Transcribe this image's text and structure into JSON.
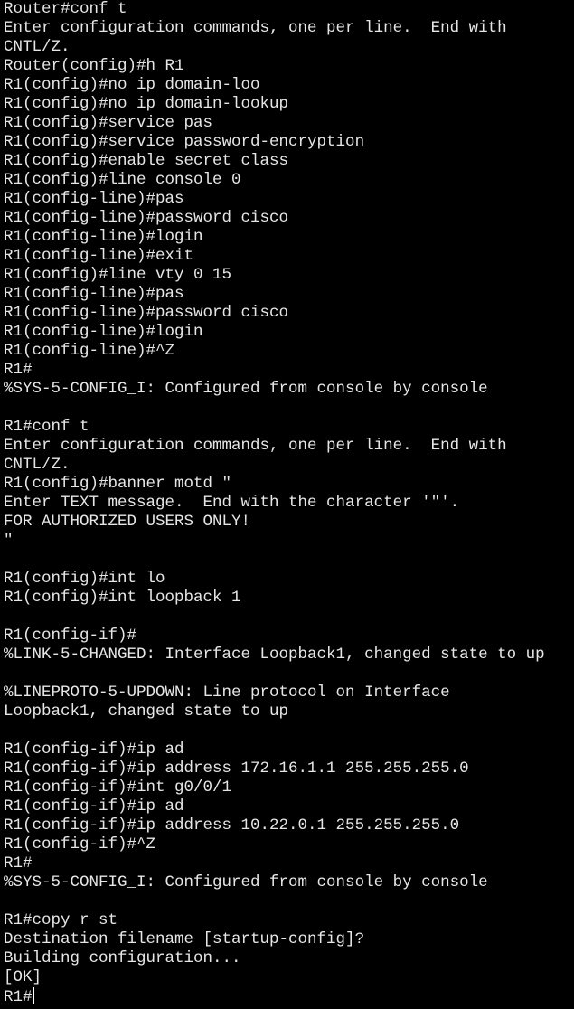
{
  "terminal": {
    "lines": [
      "Router#conf t",
      "Enter configuration commands, one per line.  End with",
      "CNTL/Z.",
      "Router(config)#h R1",
      "R1(config)#no ip domain-loo",
      "R1(config)#no ip domain-lookup",
      "R1(config)#service pas",
      "R1(config)#service password-encryption",
      "R1(config)#enable secret class",
      "R1(config)#line console 0",
      "R1(config-line)#pas",
      "R1(config-line)#password cisco",
      "R1(config-line)#login",
      "R1(config-line)#exit",
      "R1(config)#line vty 0 15",
      "R1(config-line)#pas",
      "R1(config-line)#password cisco",
      "R1(config-line)#login",
      "R1(config-line)#^Z",
      "R1#",
      "%SYS-5-CONFIG_I: Configured from console by console",
      "",
      "R1#conf t",
      "Enter configuration commands, one per line.  End with",
      "CNTL/Z.",
      "R1(config)#banner motd \"",
      "Enter TEXT message.  End with the character '\"'.",
      "FOR AUTHORIZED USERS ONLY!",
      "\"",
      "",
      "R1(config)#int lo",
      "R1(config)#int loopback 1",
      "",
      "R1(config-if)#",
      "%LINK-5-CHANGED: Interface Loopback1, changed state to up",
      "",
      "%LINEPROTO-5-UPDOWN: Line protocol on Interface",
      "Loopback1, changed state to up",
      "",
      "R1(config-if)#ip ad",
      "R1(config-if)#ip address 172.16.1.1 255.255.255.0",
      "R1(config-if)#int g0/0/1",
      "R1(config-if)#ip ad",
      "R1(config-if)#ip address 10.22.0.1 255.255.255.0",
      "R1(config-if)#^Z",
      "R1#",
      "%SYS-5-CONFIG_I: Configured from console by console",
      "",
      "R1#copy r st",
      "Destination filename [startup-config]?",
      "Building configuration...",
      "[OK]"
    ],
    "prompt": "R1#",
    "colors": {
      "background": "#000000",
      "foreground": "#e6e6e6",
      "cursor": "#ffffff"
    }
  }
}
